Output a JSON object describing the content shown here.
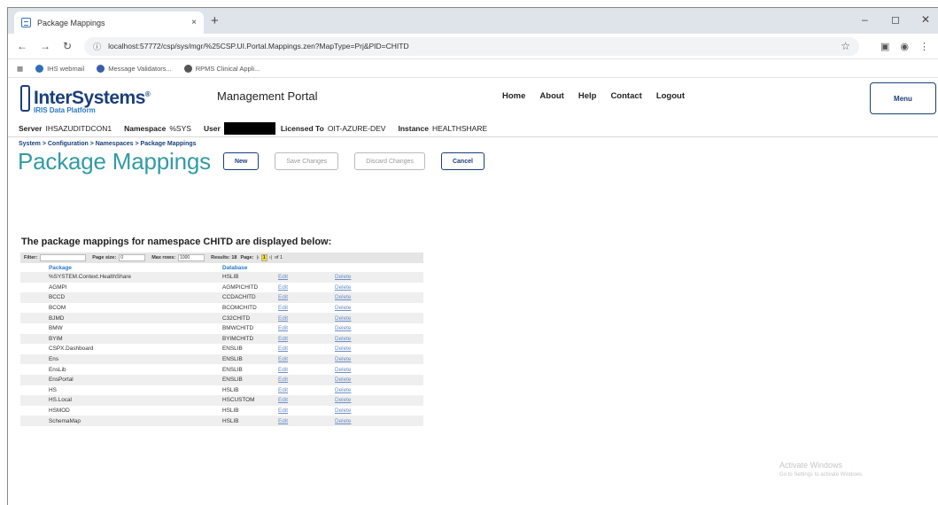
{
  "browser": {
    "tab_title": "Package Mappings",
    "tab_close": "×",
    "new_tab": "+",
    "minimize": "–",
    "maximize": "◻",
    "close": "✕",
    "back": "←",
    "forward": "→",
    "reload": "↻",
    "url": "localhost:57772/csp/sys/mgr/%25CSP.UI.Portal.Mappings.zen?MapType=Prj&PID=CHITD",
    "bookmarks": [
      {
        "label": "IHS webmail",
        "color": "#2f6fba"
      },
      {
        "label": "Message Validators...",
        "color": "#3b5da8"
      },
      {
        "label": "RPMS Clinical Appli...",
        "color": "#555555"
      }
    ]
  },
  "portal": {
    "logo_name": "InterSystems",
    "logo_tm": "®",
    "logo_sub": "IRIS Data Platform",
    "title": "Management Portal",
    "nav": [
      "Home",
      "About",
      "Help",
      "Contact",
      "Logout"
    ],
    "menu_label": "Menu"
  },
  "infobar": {
    "server_label": "Server",
    "server_value": "IHSAZUDITDCON1",
    "namespace_label": "Namespace",
    "namespace_value": "%SYS",
    "user_label": "User",
    "licensed_label": "Licensed To",
    "licensed_value": "OIT-AZURE-DEV",
    "instance_label": "Instance",
    "instance_value": "HEALTHSHARE"
  },
  "breadcrumb": "System > Configuration > Namespaces > Package Mappings",
  "page": {
    "title": "Package Mappings",
    "buttons": {
      "new": "New",
      "save": "Save Changes",
      "discard": "Discard Changes",
      "cancel": "Cancel"
    },
    "description": "The package mappings for namespace CHITD are displayed below:"
  },
  "table_controls": {
    "filter_label": "Filter:",
    "page_size_label": "Page size:",
    "page_size_value": "0",
    "max_rows_label": "Max rows:",
    "max_rows_value": "1000",
    "results_label": "Results: 18",
    "page_label": "Page:",
    "page_value": "1",
    "page_of": "of 1"
  },
  "table": {
    "headers": [
      "Package",
      "Database"
    ],
    "edit_label": "Edit",
    "delete_label": "Delete",
    "rows": [
      {
        "package": "%SYSTEM.Context.HealthShare",
        "database": "HSLIB"
      },
      {
        "package": "AGMPI",
        "database": "AGMPICHITD"
      },
      {
        "package": "BCCD",
        "database": "CCDACHITD"
      },
      {
        "package": "BCOM",
        "database": "BCOMCHITD"
      },
      {
        "package": "BJMD",
        "database": "C32CHITD"
      },
      {
        "package": "BMW",
        "database": "BMWCHITD"
      },
      {
        "package": "BYIM",
        "database": "BYIMCHITD"
      },
      {
        "package": "CSPX.Dashboard",
        "database": "ENSLIB"
      },
      {
        "package": "Ens",
        "database": "ENSLIB"
      },
      {
        "package": "EnsLib",
        "database": "ENSLIB"
      },
      {
        "package": "EnsPortal",
        "database": "ENSLIB"
      },
      {
        "package": "HS",
        "database": "HSLIB"
      },
      {
        "package": "HS.Local",
        "database": "HSCUSTOM"
      },
      {
        "package": "HSMOD",
        "database": "HSLIB"
      },
      {
        "package": "SchemaMap",
        "database": "HSLIB"
      }
    ]
  },
  "watermark": {
    "title": "Activate Windows",
    "subtitle": "Go to Settings to activate Windows."
  }
}
